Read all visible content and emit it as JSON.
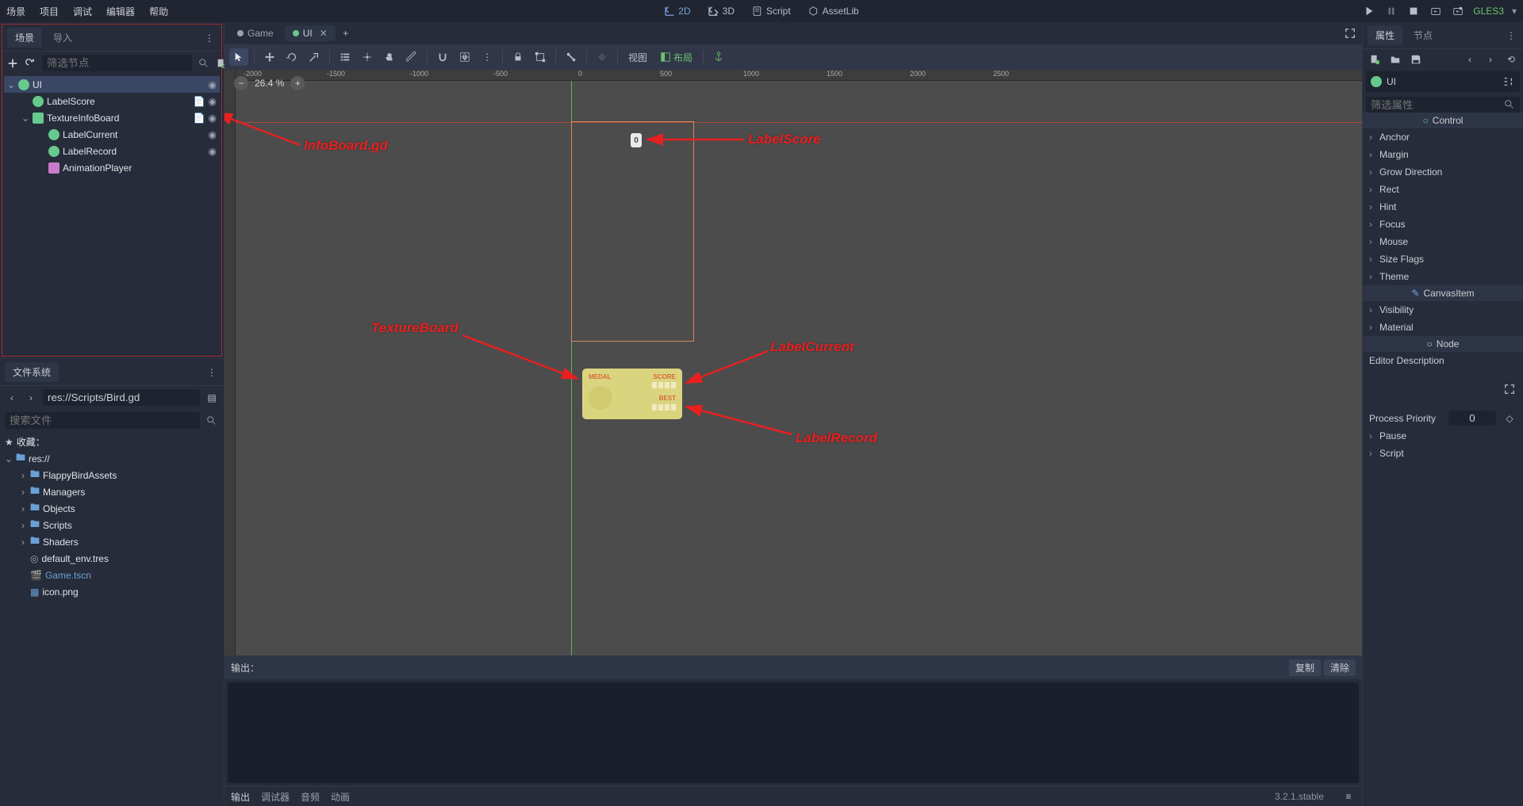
{
  "top_menu": {
    "scene": "场景",
    "project": "项目",
    "debug": "调试",
    "editor": "编辑器",
    "help": "帮助",
    "two_d": "2D",
    "three_d": "3D",
    "script": "Script",
    "assetlib": "AssetLib",
    "gles": "GLES3"
  },
  "scene_panel": {
    "tab_scene": "场景",
    "tab_import": "导入",
    "filter_placeholder": "筛选节点",
    "nodes": {
      "ui": "UI",
      "label_score": "LabelScore",
      "texture_info_board": "TextureInfoBoard",
      "label_current": "LabelCurrent",
      "label_record": "LabelRecord",
      "animation_player": "AnimationPlayer"
    }
  },
  "filesystem": {
    "title": "文件系统",
    "path": "res://Scripts/Bird.gd",
    "search_placeholder": "搜索文件",
    "favorites": "收藏：",
    "root": "res://",
    "items": {
      "flappy": "FlappyBirdAssets",
      "managers": "Managers",
      "objects": "Objects",
      "scripts": "Scripts",
      "shaders": "Shaders",
      "default_env": "default_env.tres",
      "game_tscn": "Game.tscn",
      "icon_png": "icon.png"
    }
  },
  "viewport": {
    "tab_game": "Game",
    "tab_ui": "UI",
    "zoom": "26.4 %",
    "view_btn": "视图",
    "layout_btn": "布局",
    "ruler_ticks": [
      "-2000",
      "-1500",
      "-1000",
      "-500",
      "0",
      "500",
      "1000",
      "1500",
      "2000",
      "2500"
    ],
    "texture_board": {
      "medal": "MEDAL",
      "score": "SCORE",
      "best": "BEST"
    },
    "score_display": "0"
  },
  "annotations": {
    "info_board": "InfoBoard.gd",
    "label_score": "LabelScore",
    "texture_board": "TextureBoard",
    "label_current": "LabelCurrent",
    "label_record": "LabelRecord"
  },
  "output": {
    "title": "输出：",
    "copy": "复制",
    "clear": "清除",
    "tabs": {
      "output": "输出",
      "debugger": "调试器",
      "audio": "音频",
      "animation": "动画"
    },
    "version": "3.2.1.stable"
  },
  "inspector": {
    "tab_props": "属性",
    "tab_node": "节点",
    "node_name": "UI",
    "filter_placeholder": "筛选属性",
    "sections": {
      "control": "Control",
      "canvasitem": "CanvasItem",
      "node": "Node"
    },
    "props": {
      "anchor": "Anchor",
      "margin": "Margin",
      "grow": "Grow Direction",
      "rect": "Rect",
      "hint": "Hint",
      "focus": "Focus",
      "mouse": "Mouse",
      "sizeflags": "Size Flags",
      "theme": "Theme",
      "visibility": "Visibility",
      "material": "Material",
      "editor_desc": "Editor Description",
      "process_priority": "Process Priority",
      "priority_val": "0",
      "pause": "Pause",
      "script": "Script"
    }
  }
}
